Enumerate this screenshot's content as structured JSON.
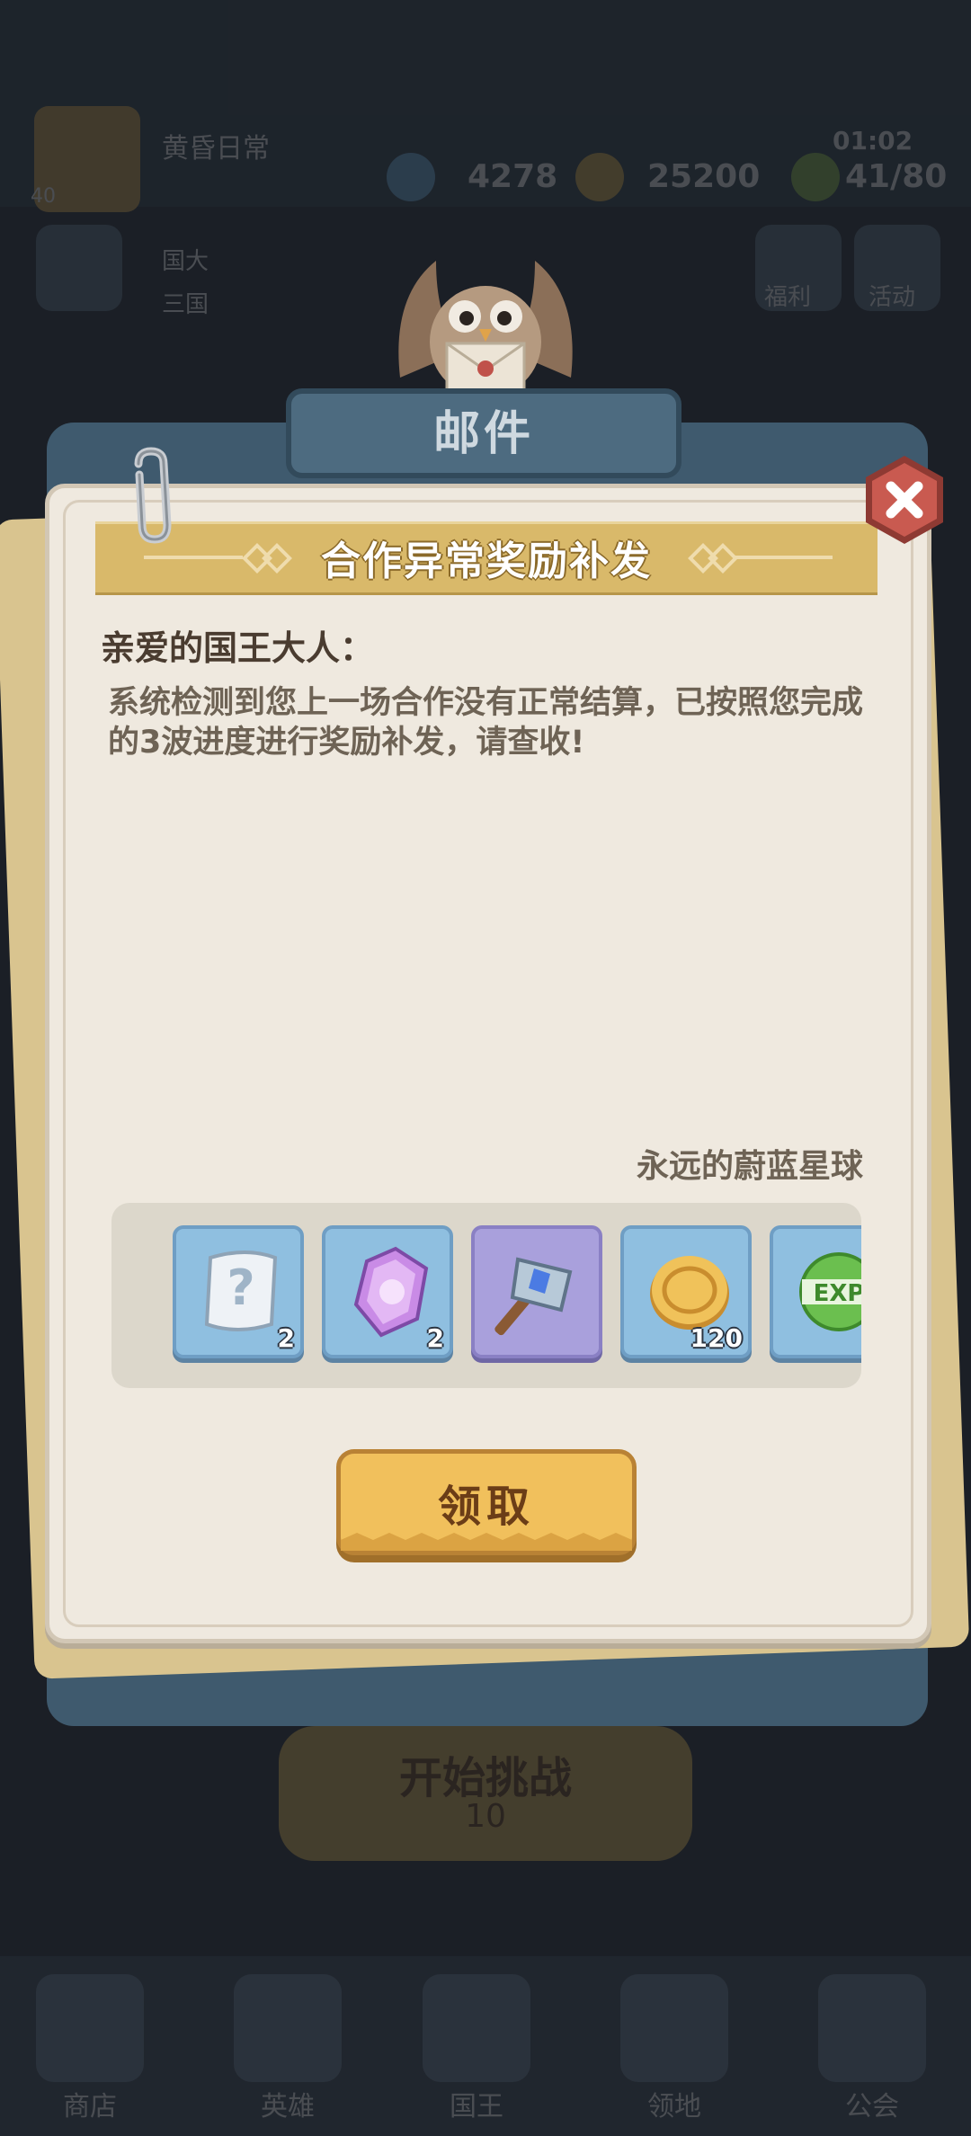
{
  "background": {
    "player_name": "黄昏日常",
    "player_level": "40",
    "resources": [
      {
        "icon": "diamond-icon",
        "value": "4278"
      },
      {
        "icon": "gold-coin-icon",
        "value": "25200"
      },
      {
        "icon": "stamina-icon",
        "value": "41/80"
      }
    ],
    "timer": "01:02",
    "side_labels": [
      "国大",
      "三国",
      "福利",
      "活动"
    ],
    "start_button": {
      "label": "开始挑战",
      "cost": "10"
    },
    "nav": [
      "商店",
      "英雄",
      "国王",
      "领地",
      "公会"
    ]
  },
  "mail": {
    "header": "邮件",
    "title": "合作异常奖励补发",
    "greeting": "亲爱的国王大人：",
    "body": "系统检测到您上一场合作没有正常结算，已按照您完成的3波进度进行奖励补发，请查收!",
    "signature": "永远的蔚蓝星球",
    "rewards": [
      {
        "icon": "mystery-scroll-icon",
        "qty": "2"
      },
      {
        "icon": "purple-crystal-icon",
        "qty": "2"
      },
      {
        "icon": "crystal-hammer-icon",
        "qty": ""
      },
      {
        "icon": "gold-coin-icon",
        "qty": "120"
      },
      {
        "icon": "exp-orb-icon",
        "qty": ""
      }
    ],
    "claim_label": "领取"
  },
  "colors": {
    "panel": "#efe9df",
    "banner": "#d9b96a",
    "claim_button": "#f1c05c",
    "close_button": "#c0524a",
    "item_blue": "#8fbfe0",
    "item_purple": "#a9a0dc"
  }
}
